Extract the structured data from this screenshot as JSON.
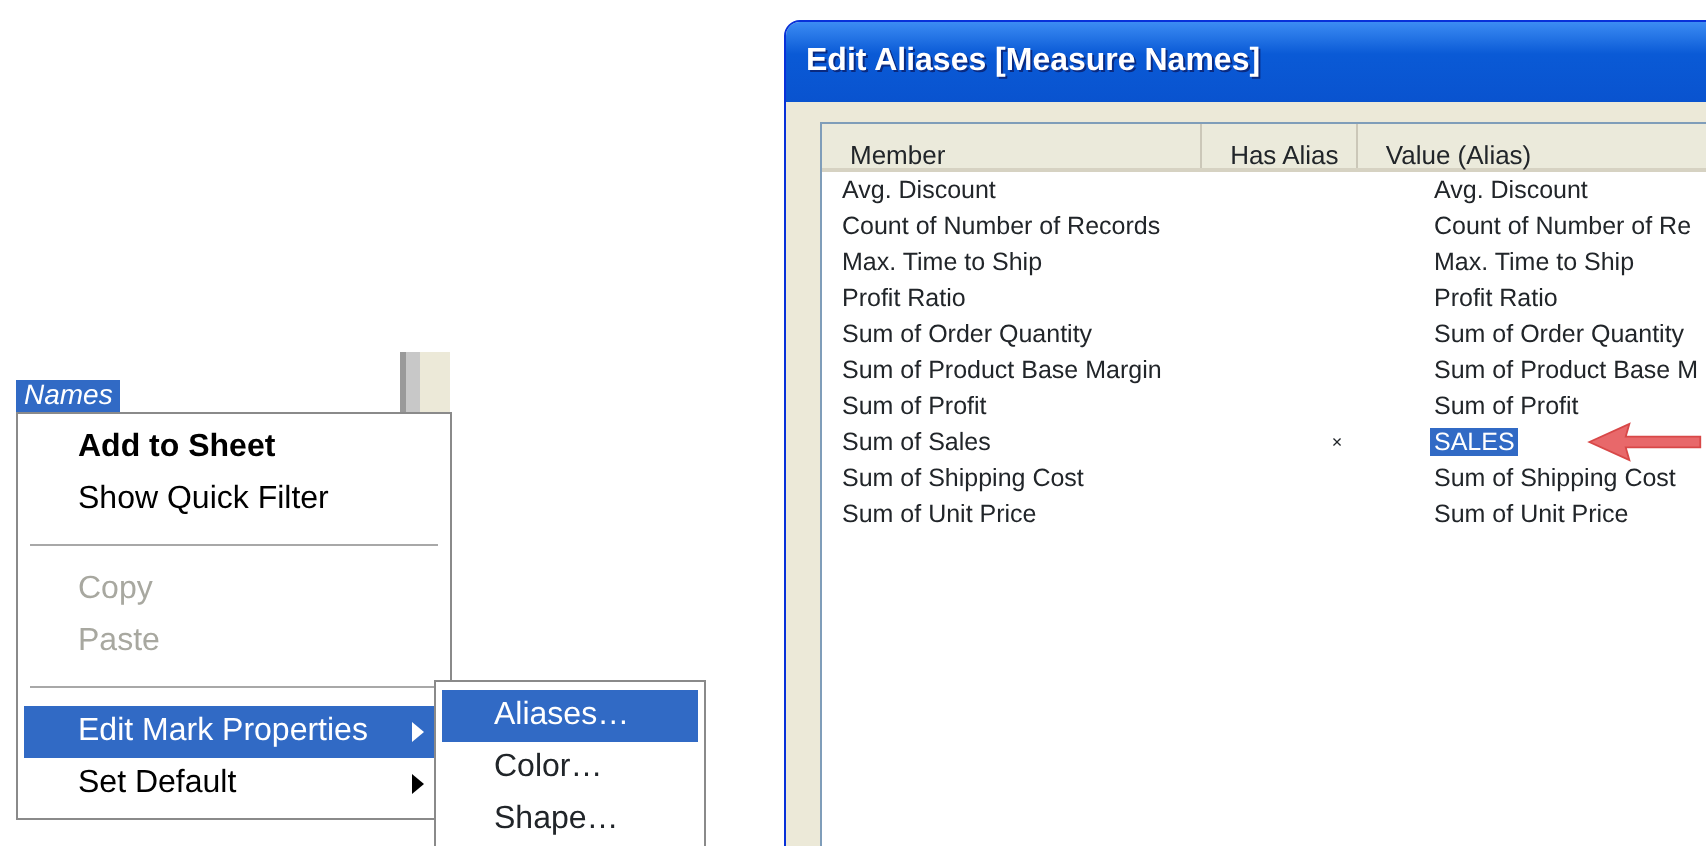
{
  "field_tag": {
    "label": "Names"
  },
  "context_menu": {
    "items": [
      {
        "kind": "item",
        "label": "Add to Sheet",
        "bold": true,
        "disabled": false,
        "selected": false,
        "submenu": false
      },
      {
        "kind": "item",
        "label": "Show Quick Filter",
        "bold": false,
        "disabled": false,
        "selected": false,
        "submenu": false
      },
      {
        "kind": "separator"
      },
      {
        "kind": "item",
        "label": "Copy",
        "bold": false,
        "disabled": true,
        "selected": false,
        "submenu": false
      },
      {
        "kind": "item",
        "label": "Paste",
        "bold": false,
        "disabled": true,
        "selected": false,
        "submenu": false
      },
      {
        "kind": "separator"
      },
      {
        "kind": "item",
        "label": "Edit Mark Properties",
        "bold": false,
        "disabled": false,
        "selected": true,
        "submenu": true
      },
      {
        "kind": "item",
        "label": "Set Default",
        "bold": false,
        "disabled": false,
        "selected": false,
        "submenu": true
      }
    ]
  },
  "submenu": {
    "items": [
      {
        "label": "Aliases…",
        "selected": true
      },
      {
        "label": "Color…",
        "selected": false
      },
      {
        "label": "Shape…",
        "selected": false
      }
    ]
  },
  "dialog": {
    "title": "Edit Aliases [Measure Names]",
    "table": {
      "columns": [
        "Member",
        "Has Alias",
        "Value (Alias)"
      ],
      "rows": [
        {
          "member": "Avg. Discount",
          "has_alias": "",
          "value": "Avg. Discount",
          "selected": false
        },
        {
          "member": "Count of Number of Records",
          "has_alias": "",
          "value": "Count of Number of Re",
          "selected": false
        },
        {
          "member": "Max. Time to Ship",
          "has_alias": "",
          "value": "Max. Time to Ship",
          "selected": false
        },
        {
          "member": "Profit Ratio",
          "has_alias": "",
          "value": "Profit Ratio",
          "selected": false
        },
        {
          "member": "Sum of Order Quantity",
          "has_alias": "",
          "value": "Sum of Order Quantity",
          "selected": false
        },
        {
          "member": "Sum of Product Base Margin",
          "has_alias": "",
          "value": "Sum of Product Base M",
          "selected": false
        },
        {
          "member": "Sum of Profit",
          "has_alias": "",
          "value": "Sum of Profit",
          "selected": false
        },
        {
          "member": "Sum of Sales",
          "has_alias": "×",
          "value": "SALES",
          "selected": true
        },
        {
          "member": "Sum of Shipping Cost",
          "has_alias": "",
          "value": "Sum of Shipping Cost",
          "selected": false
        },
        {
          "member": "Sum of Unit Price",
          "has_alias": "",
          "value": "Sum of Unit Price",
          "selected": false
        }
      ]
    }
  }
}
